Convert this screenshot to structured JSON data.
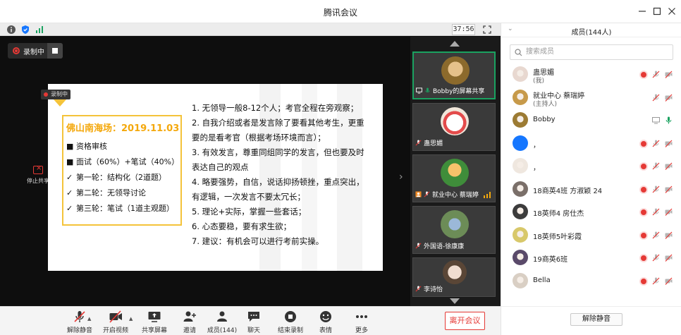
{
  "window": {
    "title": "腾讯会议"
  },
  "infobar": {
    "timer": "37:56"
  },
  "recording": {
    "label": "录制中",
    "slide_tag": "录制中"
  },
  "stop_share": {
    "label": "停止共享"
  },
  "slide": {
    "box_title": "佛山南海场：2019.11.03",
    "box_items": [
      {
        "mark": "■",
        "text": "资格审核"
      },
      {
        "mark": "■",
        "text": "面试（60%）+笔试（40%）"
      },
      {
        "mark": "✓",
        "text": "第一轮：结构化（2道题）"
      },
      {
        "mark": "✓",
        "text": "第二轮：无领导讨论"
      },
      {
        "mark": "✓",
        "text": "第三轮：笔试（1道主观题）"
      }
    ],
    "rules": [
      "1. 无领导一般8-12个人；考官全程在旁观察；",
      "2. 自我介绍或者是发言除了要看其他考生，更重",
      "要的是看考官（根据考场环境而言）；",
      "3. 有效发言，尊重同组同学的发言，但也要及时",
      "表达自己的观点",
      "4. 略要强势，自信，说话抑扬顿挫，重点突出，",
      "有逻辑，一次发言不要太冗长；",
      "5. 理论+实际，掌握一些套话；",
      "6. 心态要稳，要有求生欲；",
      "7. 建议：有机会可以进行考前实操。"
    ]
  },
  "tiles": [
    {
      "name": "Bobby的屏幕共享",
      "avatar_color": "#b68a3c",
      "active": true
    },
    {
      "name": "蛊思媚",
      "avatar_color": "#f2efe8",
      "active": false
    },
    {
      "name": "就业中心 蔡瑞婷",
      "avatar_color": "#e8a33b",
      "active": false
    },
    {
      "name": "外国语-徐康康",
      "avatar_color": "#86a56b",
      "active": false
    },
    {
      "name": "李诗怡",
      "avatar_color": "#d9c4b6",
      "active": false
    }
  ],
  "toolbar": {
    "unmute": "解除静音",
    "video": "开启视频",
    "share": "共享屏幕",
    "invite": "邀请",
    "members": "成员(144)",
    "chat": "聊天",
    "stop_record": "结束录制",
    "emoji": "表情",
    "more": "更多",
    "leave": "离开会议"
  },
  "panel": {
    "title": "成员(144人)",
    "search_placeholder": "搜索成员",
    "unmute_all": "解除静音",
    "members": [
      {
        "name": "蛊思媚",
        "sub": "(我)",
        "color": "#e8d8d0",
        "rec": true,
        "mic": "muted",
        "cam": "off"
      },
      {
        "name": "就业中心 蔡瑞婷",
        "sub": "(主持人)",
        "color": "#c79a4a",
        "rec": false,
        "mic": "muted",
        "cam": "off"
      },
      {
        "name": "Bobby",
        "sub": "",
        "color": "#9c7b33",
        "rec": false,
        "mic": "on",
        "cam": "screen"
      },
      {
        "name": "，",
        "sub": "",
        "color": "#1677ff",
        "rec": true,
        "mic": "muted",
        "cam": "off"
      },
      {
        "name": "，",
        "sub": "",
        "color": "#efe7df",
        "rec": true,
        "mic": "muted",
        "cam": "off"
      },
      {
        "name": "18商英4班 方淑颖 24",
        "sub": "",
        "color": "#7a6f69",
        "rec": true,
        "mic": "muted",
        "cam": "off"
      },
      {
        "name": "18英师4 房仕杰",
        "sub": "",
        "color": "#3c3c3c",
        "rec": true,
        "mic": "muted",
        "cam": "off"
      },
      {
        "name": "18英师5叶彩霞",
        "sub": "",
        "color": "#d8c86a",
        "rec": true,
        "mic": "muted",
        "cam": "off"
      },
      {
        "name": "19商英6班",
        "sub": "",
        "color": "#5a4a6a",
        "rec": true,
        "mic": "muted",
        "cam": "off"
      },
      {
        "name": "Bella",
        "sub": "",
        "color": "#d9cfc4",
        "rec": true,
        "mic": "muted",
        "cam": "off"
      }
    ]
  }
}
